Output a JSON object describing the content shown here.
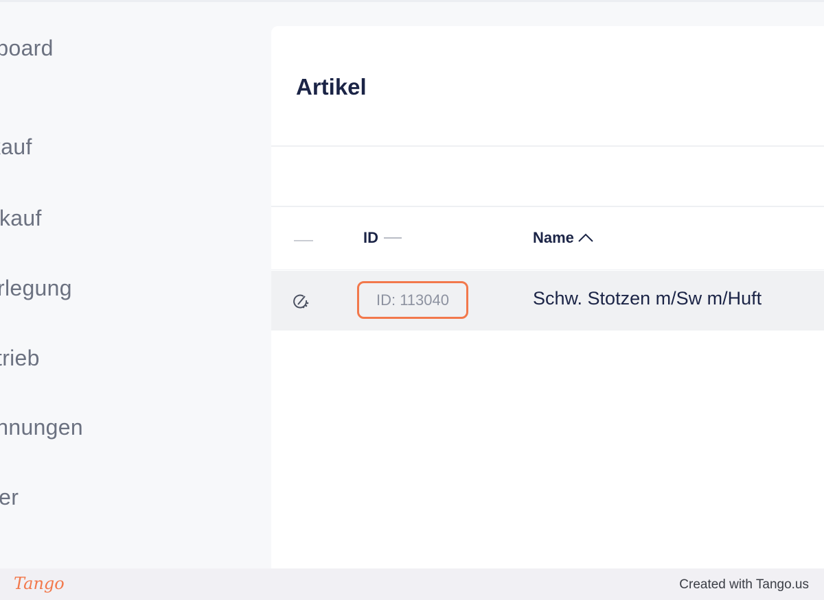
{
  "sidebar": {
    "items": [
      {
        "label": "shboard"
      },
      {
        "label": "kauf"
      },
      {
        "label": "rkauf"
      },
      {
        "label": "rlegung"
      },
      {
        "label": "trieb"
      },
      {
        "label": "chnungen"
      },
      {
        "label": "ger"
      }
    ]
  },
  "main": {
    "title": "Artikel",
    "table": {
      "columns": [
        {
          "label": "ID"
        },
        {
          "label": "Name"
        }
      ],
      "rows": [
        {
          "id": "ID: 113040",
          "name": "Schw. Stotzen m/Sw m/Huft"
        }
      ]
    }
  },
  "footer": {
    "logo": "Tango",
    "credit": "Created with Tango.us"
  },
  "colors": {
    "accent": "#f2784b",
    "text": "#1b2446",
    "muted": "#6b7180",
    "row_bg": "#f0f1f3"
  }
}
